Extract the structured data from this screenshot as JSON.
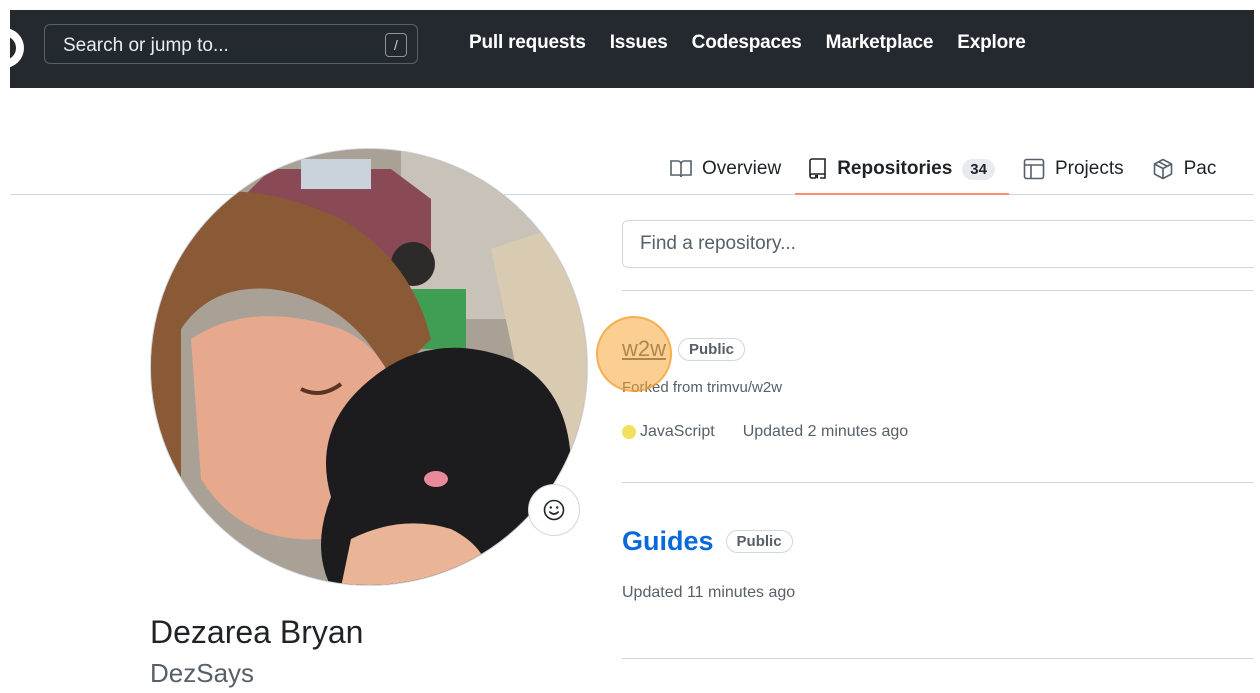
{
  "header": {
    "search_placeholder": "Search or jump to...",
    "search_key": "/",
    "nav": [
      "Pull requests",
      "Issues",
      "Codespaces",
      "Marketplace",
      "Explore"
    ]
  },
  "tabs": [
    {
      "label": "Overview",
      "icon": "book-icon"
    },
    {
      "label": "Repositories",
      "icon": "repo-icon",
      "count": "34",
      "active": true
    },
    {
      "label": "Projects",
      "icon": "table-icon"
    },
    {
      "label": "Pac",
      "icon": "package-icon"
    }
  ],
  "profile": {
    "name": "Dezarea Bryan",
    "login": "DezSays"
  },
  "repo_filter": {
    "placeholder": "Find a repository..."
  },
  "repos": [
    {
      "name": "w2w",
      "visibility": "Public",
      "forked_from": "Forked from trimvu/w2w",
      "language": "JavaScript",
      "language_color": "#f1e05a",
      "updated": "Updated 2 minutes ago"
    },
    {
      "name": "Guides",
      "visibility": "Public",
      "updated": "Updated 11 minutes ago"
    }
  ],
  "colors": {
    "header_bg": "#24292f",
    "link": "#0969da",
    "active_tab_underline": "#fd8c73",
    "click_highlight": "#f7a836"
  }
}
